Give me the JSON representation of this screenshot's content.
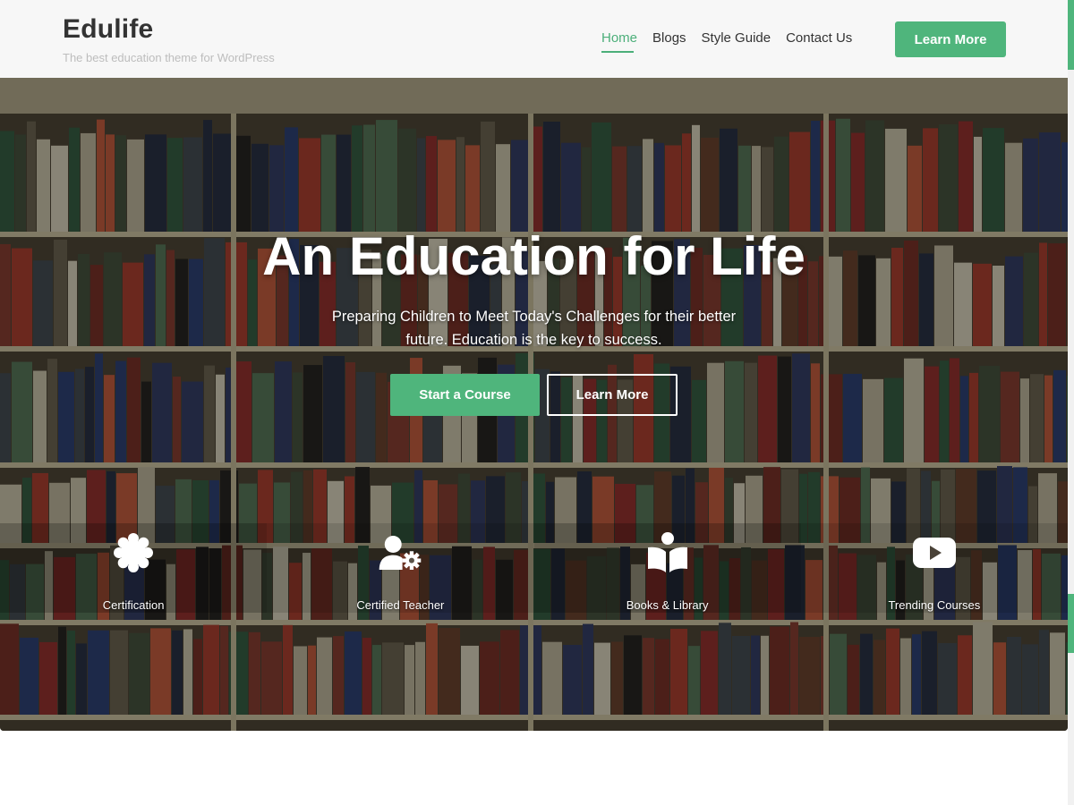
{
  "header": {
    "site_title": "Edulife",
    "tagline": "The best education theme for WordPress",
    "nav": [
      {
        "label": "Home",
        "active": true
      },
      {
        "label": "Blogs",
        "active": false
      },
      {
        "label": "Style Guide",
        "active": false
      },
      {
        "label": "Contact Us",
        "active": false
      }
    ],
    "cta_label": "Learn More"
  },
  "hero": {
    "title": "An Education for Life",
    "subtitle": "Preparing Children to Meet Today's Challenges for their better future. Education is the key to success.",
    "primary_button": "Start a Course",
    "secondary_button": "Learn More",
    "background_icon": "library-bookshelf-photo"
  },
  "features": [
    {
      "label": "Certification",
      "icon": "certificate-seal-icon"
    },
    {
      "label": "Certified Teacher",
      "icon": "user-gear-icon"
    },
    {
      "label": "Books & Library",
      "icon": "book-reader-icon"
    },
    {
      "label": "Trending Courses",
      "icon": "youtube-play-icon"
    }
  ],
  "colors": {
    "accent": "#4fb57c",
    "text_dark": "#333333",
    "tagline": "#bdbdbd"
  }
}
